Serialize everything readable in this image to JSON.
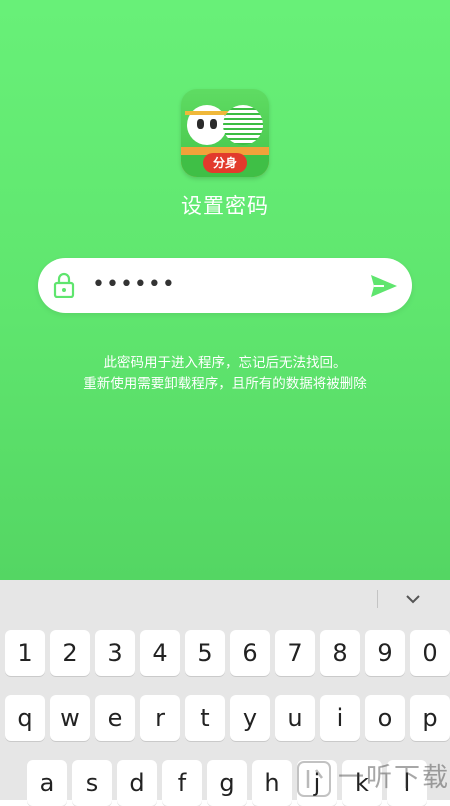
{
  "app": {
    "badge": "分身",
    "title": "设置密码"
  },
  "password": {
    "value": "••••••"
  },
  "hint": {
    "line1": "此密码用于进入程序，忘记后无法找回。",
    "line2": "重新使用需要卸载程序，且所有的数据将被删除"
  },
  "keyboard": {
    "row1": [
      "1",
      "2",
      "3",
      "4",
      "5",
      "6",
      "7",
      "8",
      "9",
      "0"
    ],
    "row2": [
      "q",
      "w",
      "e",
      "r",
      "t",
      "y",
      "u",
      "i",
      "o",
      "p"
    ],
    "row3": [
      "a",
      "s",
      "d",
      "f",
      "g",
      "h",
      "j",
      "k",
      "l"
    ]
  },
  "watermark": {
    "text": "一听下载"
  },
  "colors": {
    "accent": "#5fe56e",
    "send": "#5fe56e",
    "badge": "#e23a2c"
  },
  "icons": {
    "lock": "lock-icon",
    "send": "send-icon",
    "collapse": "chevron-down-icon"
  }
}
